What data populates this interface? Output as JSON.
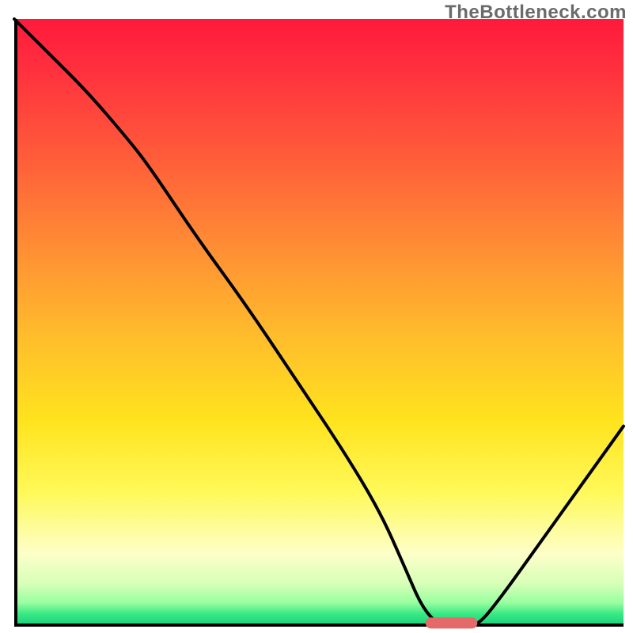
{
  "watermark": "TheBottleneck.com",
  "chart_data": {
    "type": "line",
    "title": "",
    "xlabel": "",
    "ylabel": "",
    "xlim": [
      0,
      100
    ],
    "ylim": [
      0,
      100
    ],
    "grid": false,
    "legend": false,
    "gradient_colors_top_to_bottom": [
      "#ff1a3c",
      "#ff2f3e",
      "#ff5a3a",
      "#ff8f34",
      "#ffbc2c",
      "#ffe31e",
      "#fff95a",
      "#fdffc9",
      "#d6ffb7",
      "#9affa0",
      "#35e884",
      "#18cf7b"
    ],
    "curve_notes": "Black curve representing bottleneck; x =~ configuration axis, y =~ bottleneck severity (100=worst/red, 0=best/green). Curve drops from top-left, inflects near x≈22,y≈76, continues down to a flat minimum y≈0 over x≈67–76, then rises to y≈33 at x=100.",
    "series": [
      {
        "name": "bottleneck-curve",
        "color": "#000000",
        "x": [
          0,
          6,
          12,
          18,
          22,
          30,
          38,
          46,
          54,
          60,
          64,
          67,
          70,
          73,
          76,
          80,
          85,
          90,
          95,
          100
        ],
        "y": [
          100,
          94,
          88,
          81,
          76,
          64,
          53,
          41,
          29,
          19,
          10,
          3,
          0,
          0,
          0,
          5,
          12,
          19,
          26,
          33
        ]
      }
    ],
    "optimal_marker": {
      "color": "#e46a6a",
      "shape": "rounded-bar",
      "x_range": [
        67.5,
        76
      ],
      "y": 0.6,
      "description": "Pink pill at the flat minimum of the curve indicating the no-bottleneck sweet spot."
    }
  }
}
